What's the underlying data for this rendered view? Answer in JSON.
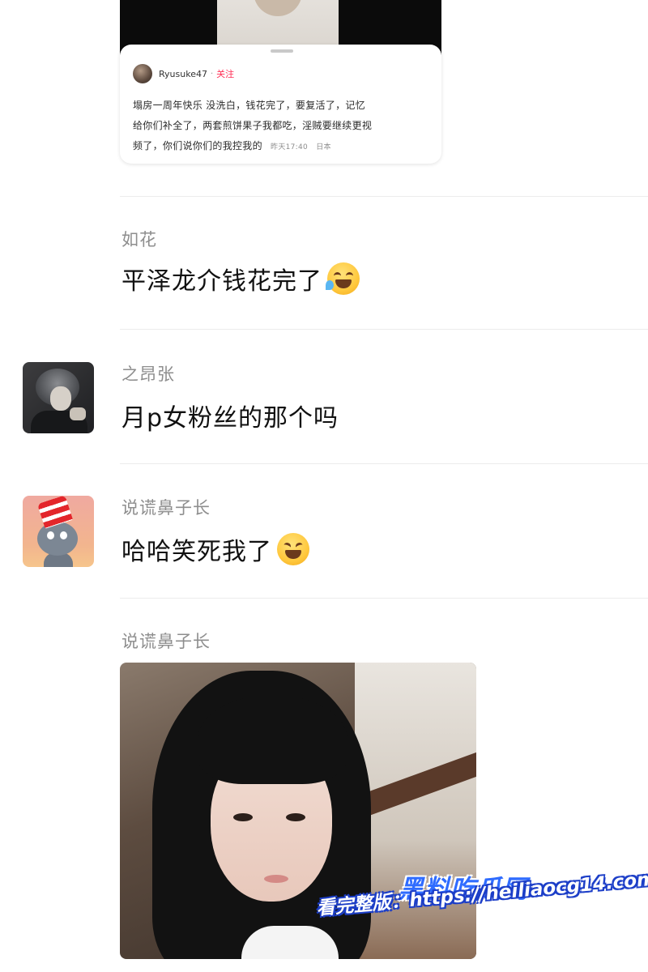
{
  "quoted_post": {
    "username": "Ryusuke47",
    "separator": "·",
    "follow_label": "关注",
    "line1": "塌房一周年快乐 没洗白，钱花完了，要复活了，记忆",
    "line2": "给你们补全了，两套煎饼果子我都吃，淫贼要继续更视",
    "line3": "频了，你们说你们的我控我的",
    "meta_time": "昨天17:40",
    "meta_location": "日本"
  },
  "comments": [
    {
      "name": "如花",
      "text": "平泽龙介钱花完了",
      "emoji": "crying-laughing-emoji"
    },
    {
      "name": "之昂张",
      "text": "月p女粉丝的那个吗",
      "avatar": "anime-character-avatar"
    },
    {
      "name": "说谎鼻子长",
      "text": "哈哈笑死我了",
      "emoji": "grinning-squinting-emoji",
      "avatar": "cat-in-striped-hat-avatar"
    },
    {
      "name": "说谎鼻子长",
      "image": "selfie-photo"
    }
  ],
  "watermark": {
    "title": "黑料吃瓜网",
    "subtitle": "看完整版：https://heiliaocg14.com"
  },
  "colors": {
    "follow": "#ff2e54",
    "name_gray": "#8e8e8e",
    "watermark_blue": "#2f6cff"
  }
}
